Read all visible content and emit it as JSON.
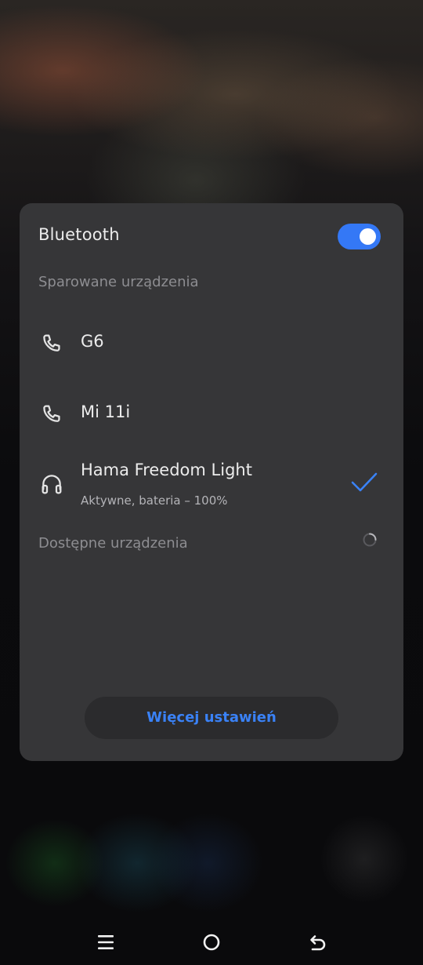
{
  "panel": {
    "title": "Bluetooth",
    "toggle_on": true,
    "accent_color": "#3478f6",
    "paired_section_label": "Sparowane urządzenia",
    "paired_devices": [
      {
        "name": "G6",
        "icon": "phone-icon"
      },
      {
        "name": "Mi 11i",
        "icon": "phone-icon"
      },
      {
        "name": "Hama Freedom Light",
        "icon": "headphones-icon",
        "status": "Aktywne, bateria – 100%",
        "connected": true
      }
    ],
    "available_section_label": "Dostępne urządzenia",
    "more_settings_label": "Więcej ustawień"
  },
  "navbar": {
    "buttons": [
      "menu-icon",
      "home-icon",
      "back-icon"
    ]
  }
}
